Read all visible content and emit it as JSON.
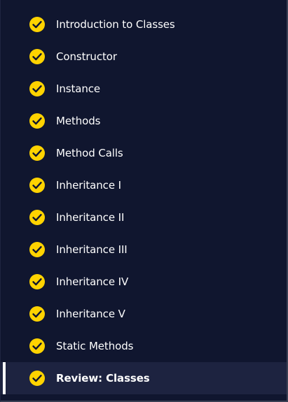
{
  "lessons": [
    {
      "label": "Introduction to Classes",
      "completed": true,
      "active": false
    },
    {
      "label": "Constructor",
      "completed": true,
      "active": false
    },
    {
      "label": "Instance",
      "completed": true,
      "active": false
    },
    {
      "label": "Methods",
      "completed": true,
      "active": false
    },
    {
      "label": "Method Calls",
      "completed": true,
      "active": false
    },
    {
      "label": "Inheritance I",
      "completed": true,
      "active": false
    },
    {
      "label": "Inheritance II",
      "completed": true,
      "active": false
    },
    {
      "label": "Inheritance III",
      "completed": true,
      "active": false
    },
    {
      "label": "Inheritance IV",
      "completed": true,
      "active": false
    },
    {
      "label": "Inheritance V",
      "completed": true,
      "active": false
    },
    {
      "label": "Static Methods",
      "completed": true,
      "active": false
    },
    {
      "label": "Review: Classes",
      "completed": true,
      "active": true
    }
  ],
  "colors": {
    "background": "#10162f",
    "active_background": "#1d2340",
    "check_fill": "#ffd300",
    "check_mark": "#10162f",
    "text": "#ffffff"
  },
  "icons": {
    "completed": "check-circle-icon"
  }
}
